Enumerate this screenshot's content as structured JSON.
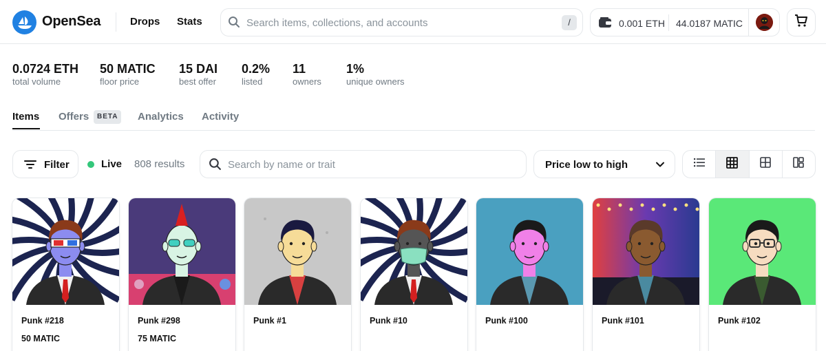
{
  "header": {
    "brand": "OpenSea",
    "nav": [
      "Drops",
      "Stats"
    ],
    "search_placeholder": "Search items, collections, and accounts",
    "search_shortcut": "/",
    "wallet": {
      "eth": "0.001 ETH",
      "matic": "44.0187 MATIC"
    }
  },
  "stats": [
    {
      "value": "0.0724 ETH",
      "label": "total volume"
    },
    {
      "value": "50 MATIC",
      "label": "floor price"
    },
    {
      "value": "15 DAI",
      "label": "best offer"
    },
    {
      "value": "0.2%",
      "label": "listed"
    },
    {
      "value": "11",
      "label": "owners"
    },
    {
      "value": "1%",
      "label": "unique owners"
    }
  ],
  "tabs": [
    {
      "label": "Items",
      "active": true
    },
    {
      "label": "Offers",
      "badge": "BETA"
    },
    {
      "label": "Analytics"
    },
    {
      "label": "Activity"
    }
  ],
  "toolbar": {
    "filter_label": "Filter",
    "live_label": "Live",
    "results": "808 results",
    "search_placeholder": "Search by name or trait",
    "sort_label": "Price low to high",
    "view_modes": [
      "list",
      "grid-small",
      "grid-medium",
      "grid-large"
    ],
    "selected_view": "grid-small"
  },
  "items": [
    {
      "name": "Punk #218",
      "price": "50 MATIC",
      "bg": "swirl",
      "skin": "#8c8cf0",
      "hair": "#8a3a1a",
      "accessory": "3d-glasses",
      "shirt": "#f0f0f0",
      "tie": "#d42020"
    },
    {
      "name": "Punk #298",
      "price": "75 MATIC",
      "bg": "party",
      "skin": "#d8f4e4",
      "hair": "#d82020",
      "accessory": "shades",
      "shirt": "#1a1a1a"
    },
    {
      "name": "Punk #1",
      "price": "",
      "bg": "gray",
      "skin": "#f6dc98",
      "hair": "#1a1a40",
      "accessory": "none",
      "shirt": "#d84040"
    },
    {
      "name": "Punk #10",
      "price": "",
      "bg": "swirl",
      "skin": "#555555",
      "hair": "#8a3a1a",
      "accessory": "mask",
      "shirt": "#f0f0f0",
      "tie": "#d42020"
    },
    {
      "name": "Punk #100",
      "price": "",
      "bg": "teal",
      "skin": "#f080e8",
      "hair": "#1a1a1a",
      "accessory": "none",
      "shirt": "#5a98b0"
    },
    {
      "name": "Punk #101",
      "price": "",
      "bg": "concert",
      "skin": "#8a5a30",
      "hair": "#5a3a2a",
      "accessory": "none",
      "shirt": "#4a8aa0"
    },
    {
      "name": "Punk #102",
      "price": "",
      "bg": "green",
      "skin": "#f6dcc0",
      "hair": "#1a1a1a",
      "accessory": "glasses",
      "shirt": "#3a5a30"
    }
  ]
}
